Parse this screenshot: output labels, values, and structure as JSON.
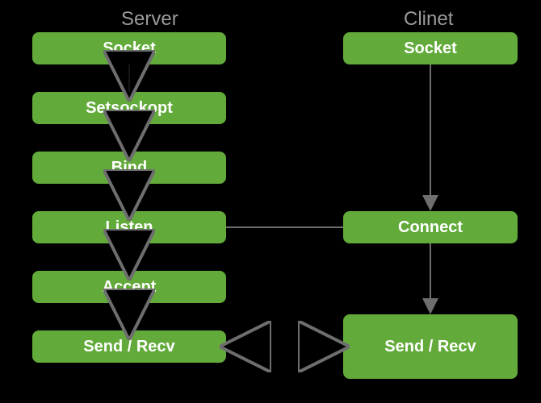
{
  "columns": {
    "server": {
      "title": "Server"
    },
    "client": {
      "title": "Clinet"
    }
  },
  "server_steps": {
    "socket": "Socket",
    "setsockopt": "Setsockopt",
    "bind": "Bind",
    "listen": "Listen",
    "accept": "Accept",
    "sendrecv": "Send / Recv"
  },
  "client_steps": {
    "socket": "Socket",
    "connect": "Connect",
    "sendrecv": "Send / Recv"
  },
  "colors": {
    "box_bg": "#62ab3a",
    "box_text": "#ffffff",
    "title_text": "#9a9a9a",
    "background": "#000000"
  }
}
